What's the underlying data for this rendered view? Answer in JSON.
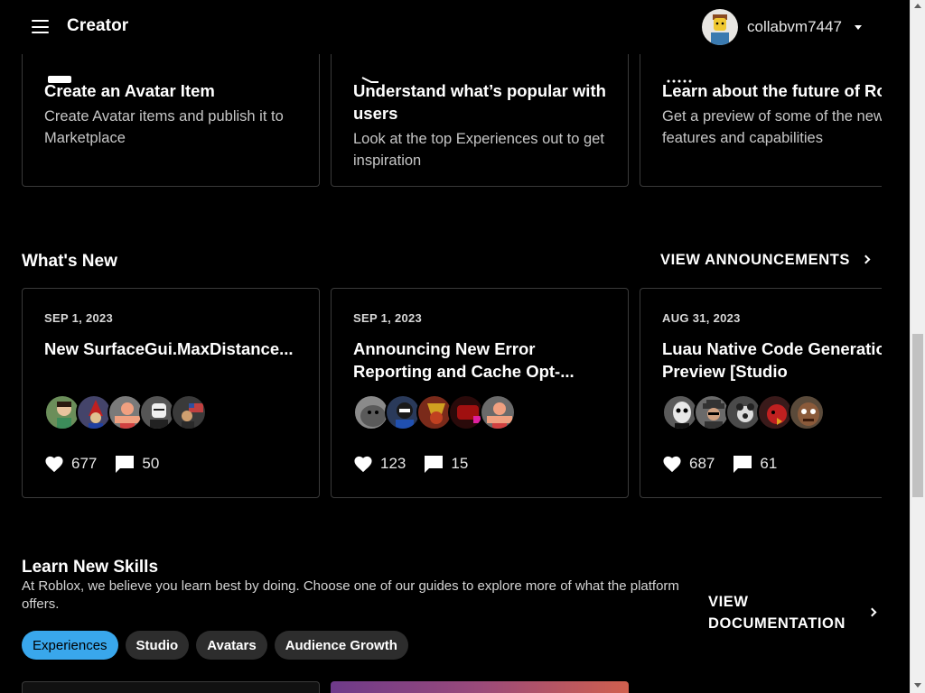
{
  "header": {
    "brand": "Creator",
    "username": "collabvm7447"
  },
  "top_cards": [
    {
      "title": "Create an Avatar Item",
      "desc": "Create Avatar items and publish it to Marketplace"
    },
    {
      "title": "Understand what’s popular with users",
      "desc": "Look at the top Experiences out to get inspiration"
    },
    {
      "title": "Learn about the future of Roblox",
      "desc": "Get a preview of some of the new features and capabilities"
    }
  ],
  "whats_new": {
    "title": "What's New",
    "link_label": "VIEW ANNOUNCEMENTS",
    "items": [
      {
        "date": "SEP 1, 2023",
        "title": "New SurfaceGui.MaxDistance...",
        "likes": "677",
        "comments": "50"
      },
      {
        "date": "SEP 1, 2023",
        "title": "Announcing New Error Reporting and Cache Opt-...",
        "likes": "123",
        "comments": "15"
      },
      {
        "date": "AUG 31, 2023",
        "title": "Luau Native Code Generation Preview [Studio",
        "likes": "687",
        "comments": "61"
      }
    ]
  },
  "learn": {
    "title": "Learn New Skills",
    "desc": "At Roblox, we believe you learn best by doing. Choose one of our guides to explore more of what the platform offers.",
    "doc_line1": "VIEW",
    "doc_line2": "DOCUMENTATION",
    "chips": [
      "Experiences",
      "Studio",
      "Avatars",
      "Audience Growth"
    ]
  },
  "colors": {
    "accent": "#39a7ec",
    "chip_bg": "#2d2d2d",
    "card_border": "#3a3a3a"
  }
}
